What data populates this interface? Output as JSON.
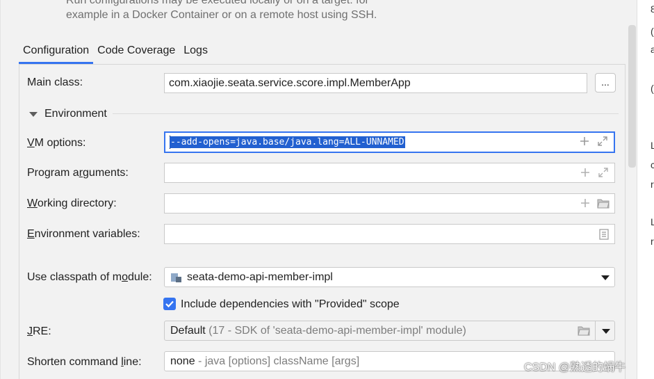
{
  "top_note": {
    "line1": "Run configurations may be executed locally or on a target: for",
    "line2": "example in a Docker Container or on a remote host using SSH."
  },
  "tabs": [
    {
      "label": "Configuration",
      "active": true
    },
    {
      "label": "Code Coverage",
      "active": false
    },
    {
      "label": "Logs",
      "active": false
    }
  ],
  "main_class": {
    "label": "Main class:",
    "value": "com.xiaojie.seata.service.score.impl.MemberApp",
    "browse_label": "..."
  },
  "environment": {
    "section_label": "Environment",
    "vm_options": {
      "label_pre": "",
      "label_ul": "V",
      "label_post": "M options:",
      "value": "--add-opens=java.base/java.lang=ALL-UNNAMED"
    },
    "program_arguments": {
      "label_pre": "Program a",
      "label_ul": "r",
      "label_post": "guments:",
      "value": ""
    },
    "working_directory": {
      "label_pre": "",
      "label_ul": "W",
      "label_post": "orking directory:",
      "value": ""
    },
    "environment_variables": {
      "label_pre": "",
      "label_ul": "E",
      "label_post": "nvironment variables:",
      "value": ""
    }
  },
  "classpath_module": {
    "label_pre": "Use classpath of m",
    "label_ul": "o",
    "label_post": "dule:",
    "value": "seata-demo-api-member-impl"
  },
  "include_provided": {
    "label": "Include dependencies with \"Provided\" scope",
    "checked": true
  },
  "jre": {
    "label_pre": "",
    "label_ul": "J",
    "label_post": "RE:",
    "value_main": "Default",
    "value_hint": "(17 - SDK of 'seata-demo-api-member-impl' module)"
  },
  "shorten_command_line": {
    "label_pre": "Shorten command ",
    "label_ul": "l",
    "label_post": "ine:",
    "value_main": "none",
    "value_hint": "- java [options] className [args]"
  },
  "right_strip_chars": [
    "8",
    "(",
    "a",
    "(",
    "L",
    "c",
    "r",
    "L",
    "r"
  ],
  "watermark": "CSDN @熟透的蜗牛",
  "colors": {
    "accent": "#3574f0",
    "selection": "#2260d0"
  }
}
